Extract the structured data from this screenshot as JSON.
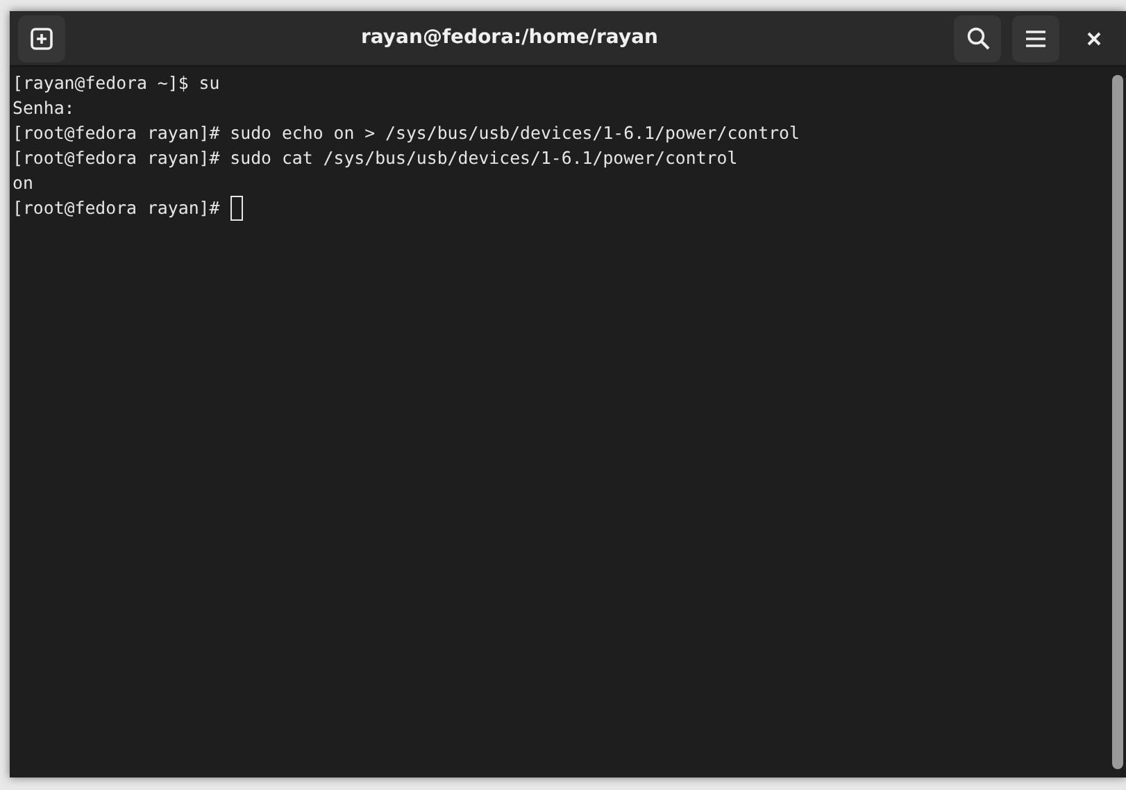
{
  "window": {
    "title": "rayan@fedora:/home/rayan"
  },
  "terminal": {
    "lines": [
      {
        "text": "[rayan@fedora ~]$ su",
        "cursor": false
      },
      {
        "text": "Senha:",
        "cursor": false
      },
      {
        "text": "[root@fedora rayan]# sudo echo on > /sys/bus/usb/devices/1-6.1/power/control",
        "cursor": false
      },
      {
        "text": "[root@fedora rayan]# sudo cat /sys/bus/usb/devices/1-6.1/power/control",
        "cursor": false
      },
      {
        "text": "on",
        "cursor": false
      },
      {
        "text": "[root@fedora rayan]# ",
        "cursor": true
      }
    ]
  }
}
